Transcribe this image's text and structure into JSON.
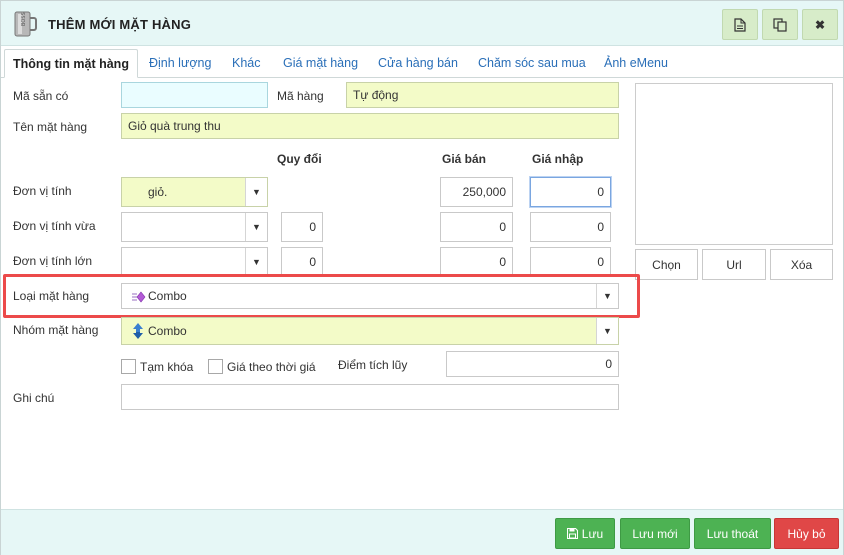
{
  "window": {
    "title": "THÊM MỚI MẶT HÀNG"
  },
  "titlebar_buttons": {
    "doc": "document-icon",
    "copy": "copy-icon",
    "close": "✖"
  },
  "tabs": [
    {
      "label": "Thông tin mặt hàng"
    },
    {
      "label": "Định lượng"
    },
    {
      "label": "Khác"
    },
    {
      "label": "Giá mặt hàng"
    },
    {
      "label": "Cửa hàng bán"
    },
    {
      "label": "Chăm sóc sau mua"
    },
    {
      "label": "Ảnh eMenu"
    }
  ],
  "form": {
    "ma_san_co_label": "Mã sẵn có",
    "ma_san_co_value": "",
    "ma_hang_label": "Mã hàng",
    "ma_hang_value": "Tự động",
    "ten_mat_hang_label": "Tên mặt hàng",
    "ten_mat_hang_value": "Giỏ quà trung thu",
    "headers": {
      "quy_doi": "Quy đổi",
      "gia_ban": "Giá bán",
      "gia_nhap": "Giá nhập"
    },
    "don_vi_tinh_label": "Đơn vị tính",
    "don_vi_tinh_value": "giỏ.",
    "don_vi_tinh_gia_ban": "250,000",
    "don_vi_tinh_gia_nhap": "0",
    "don_vi_tinh_vua_label": "Đơn vị tính vừa",
    "don_vi_tinh_vua_value": "",
    "don_vi_tinh_vua_quy_doi": "0",
    "don_vi_tinh_vua_gia_ban": "0",
    "don_vi_tinh_vua_gia_nhap": "0",
    "don_vi_tinh_lon_label": "Đơn vị tính lớn",
    "don_vi_tinh_lon_value": "",
    "don_vi_tinh_lon_quy_doi": "0",
    "don_vi_tinh_lon_gia_ban": "0",
    "don_vi_tinh_lon_gia_nhap": "0",
    "loai_mat_hang_label": "Loại mặt hàng",
    "loai_mat_hang_value": "Combo",
    "nhom_mat_hang_label": "Nhóm mặt hàng",
    "nhom_mat_hang_value": "Combo",
    "tam_khoa_label": "Tạm khóa",
    "gia_theo_thoi_gia_label": "Giá theo thời giá",
    "diem_tich_luy_label": "Điểm tích lũy",
    "diem_tich_luy_value": "0",
    "ghi_chu_label": "Ghi chú",
    "ghi_chu_value": ""
  },
  "image_buttons": {
    "chon": "Chọn",
    "url": "Url",
    "xoa": "Xóa"
  },
  "footer": {
    "luu": "Lưu",
    "luu_moi": "Lưu mới",
    "luu_thoat": "Lưu thoát",
    "huy_bo": "Hủy bỏ"
  },
  "colors": {
    "header_bg": "#e6f7f6",
    "yellow_field": "#f3fbc8",
    "green_button": "#4db253",
    "red_button": "#e04747",
    "highlight": "#ec4a4a",
    "tab_link": "#2a6fb8"
  }
}
